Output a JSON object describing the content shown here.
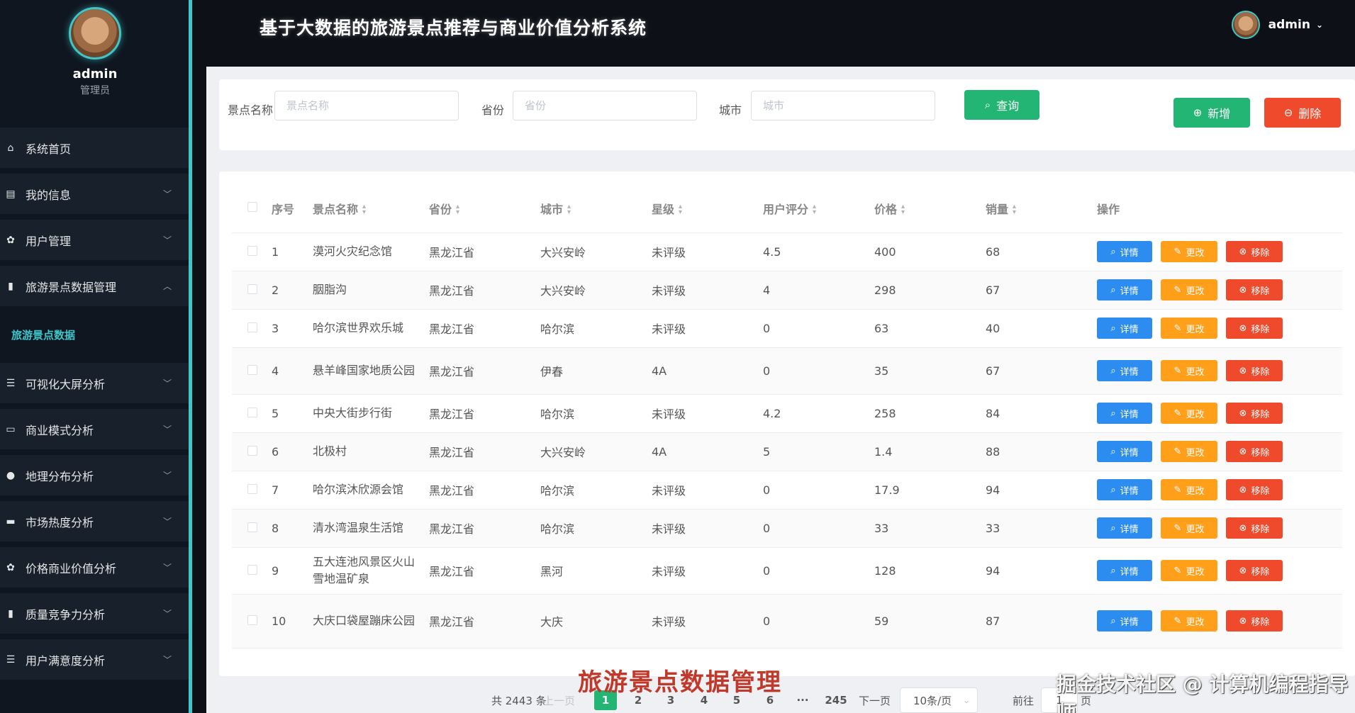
{
  "app": {
    "title": "基于大数据的旅游景点推荐与商业价值分析系统"
  },
  "user": {
    "name": "admin",
    "role": "管理员"
  },
  "sidebar": {
    "items": [
      {
        "label": "系统首页",
        "icon": "home-icon",
        "chevron": ""
      },
      {
        "label": "我的信息",
        "icon": "profile-icon",
        "chevron": "⌄"
      },
      {
        "label": "用户管理",
        "icon": "gear-icon",
        "chevron": "⌄"
      },
      {
        "label": "旅游景点数据管理",
        "icon": "bar-chart-icon",
        "chevron": "⌃"
      }
    ],
    "sub_item": "旅游景点数据",
    "items2": [
      {
        "label": "可视化大屏分析",
        "icon": "list-icon",
        "chevron": "⌄"
      },
      {
        "label": "商业模式分析",
        "icon": "monitor-icon",
        "chevron": "⌄"
      },
      {
        "label": "地理分布分析",
        "icon": "user-icon",
        "chevron": "⌄"
      },
      {
        "label": "市场热度分析",
        "icon": "ticket-icon",
        "chevron": "⌄"
      },
      {
        "label": "价格商业价值分析",
        "icon": "gear-icon",
        "chevron": "⌄"
      },
      {
        "label": "质量竞争力分析",
        "icon": "bar-chart-icon",
        "chevron": "⌄"
      },
      {
        "label": "用户满意度分析",
        "icon": "list-icon",
        "chevron": "⌄"
      }
    ]
  },
  "search": {
    "name_label": "景点名称",
    "name_placeholder": "景点名称",
    "province_label": "省份",
    "province_placeholder": "省份",
    "city_label": "城市",
    "city_placeholder": "城市",
    "query_button": "查询",
    "add_button": "新增",
    "delete_button": "删除"
  },
  "table": {
    "headers": [
      "序号",
      "景点名称",
      "省份",
      "城市",
      "星级",
      "用户评分",
      "价格",
      "销量",
      "操作"
    ],
    "rows": [
      [
        "1",
        "漠河火灾纪念馆",
        "黑龙江省",
        "大兴安岭",
        "未评级",
        "4.5",
        "400",
        "68"
      ],
      [
        "2",
        "胭脂沟",
        "黑龙江省",
        "大兴安岭",
        "未评级",
        "4",
        "298",
        "67"
      ],
      [
        "3",
        "哈尔滨世界欢乐城",
        "黑龙江省",
        "哈尔滨",
        "未评级",
        "0",
        "63",
        "40"
      ],
      [
        "4",
        "悬羊峰国家地质公园",
        "黑龙江省",
        "伊春",
        "4A",
        "0",
        "35",
        "67"
      ],
      [
        "5",
        "中央大街步行街",
        "黑龙江省",
        "哈尔滨",
        "未评级",
        "4.2",
        "258",
        "84"
      ],
      [
        "6",
        "北极村",
        "黑龙江省",
        "大兴安岭",
        "4A",
        "5",
        "1.4",
        "88"
      ],
      [
        "7",
        "哈尔滨沐欣源会馆",
        "黑龙江省",
        "哈尔滨",
        "未评级",
        "0",
        "17.9",
        "94"
      ],
      [
        "8",
        "清水湾温泉生活馆",
        "黑龙江省",
        "哈尔滨",
        "未评级",
        "0",
        "33",
        "33"
      ],
      [
        "9",
        "五大连池风景区火山雪地温矿泉",
        "黑龙江省",
        "黑河",
        "未评级",
        "0",
        "128",
        "94"
      ],
      [
        "10",
        "大庆口袋屋蹦床公园",
        "黑龙江省",
        "大庆",
        "未评级",
        "0",
        "59",
        "87"
      ]
    ],
    "ops": {
      "detail": "详情",
      "edit": "更改",
      "remove": "移除"
    }
  },
  "pagination": {
    "total": "共 2443 条",
    "prev": "上一页",
    "pages": [
      "1",
      "2",
      "3",
      "4",
      "5",
      "6"
    ],
    "ellipsis": "···",
    "last": "245",
    "next": "下一页",
    "page_size": "10条/页",
    "goto_label": "前往",
    "goto_value": "1",
    "goto_suffix": "页"
  },
  "caption": "旅游景点数据管理",
  "watermark": "掘金技术社区 @ 计算机编程指导师"
}
